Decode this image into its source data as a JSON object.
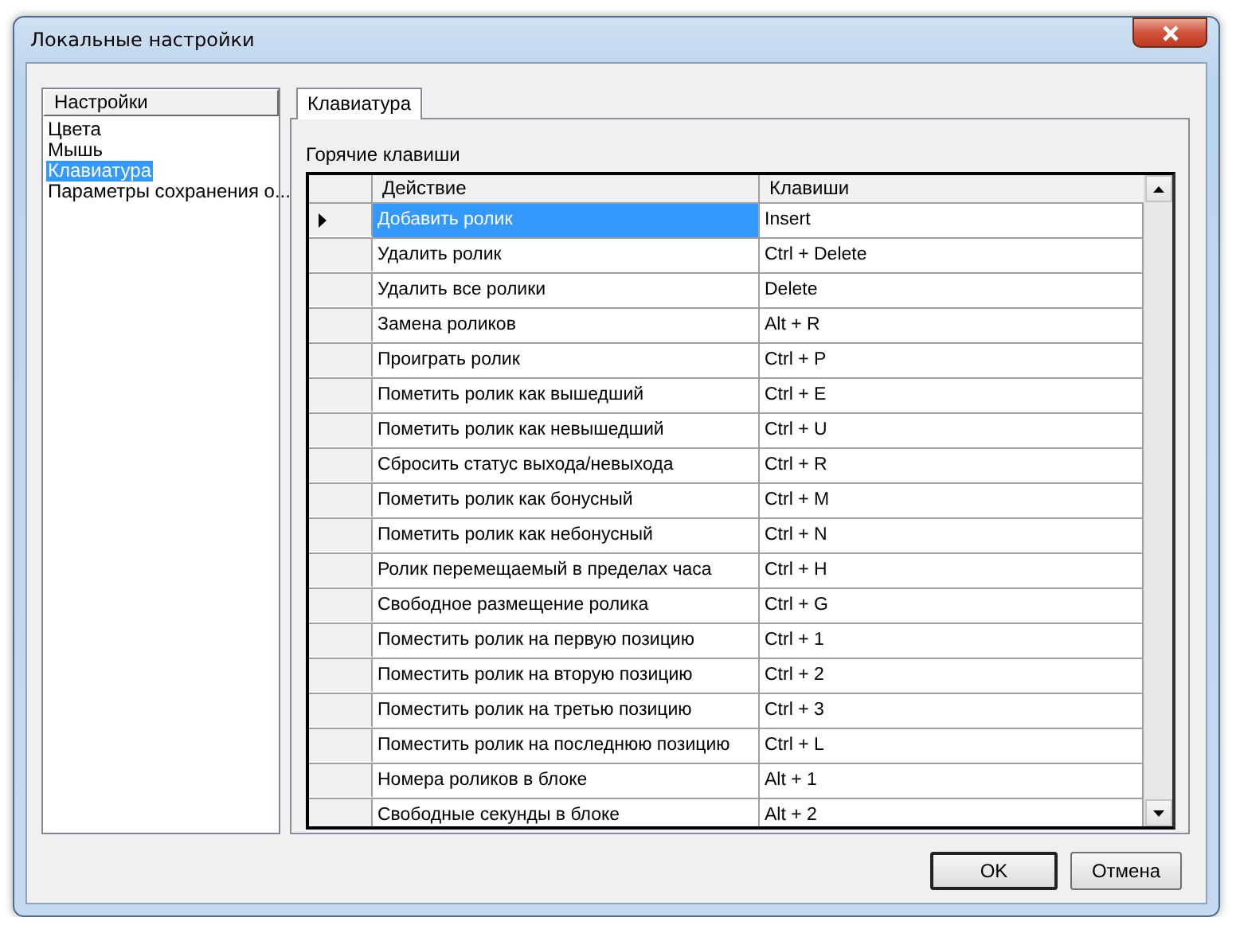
{
  "window": {
    "title": "Локальные настройки"
  },
  "sidebar": {
    "header": "Настройки",
    "items": [
      {
        "label": "Цвета",
        "selected": false
      },
      {
        "label": "Мышь",
        "selected": false
      },
      {
        "label": "Клавиатура",
        "selected": true
      },
      {
        "label": "Параметры сохранения о...",
        "selected": false
      }
    ]
  },
  "tabs": [
    {
      "label": "Клавиатура",
      "selected": true
    }
  ],
  "group_label": "Горячие клавиши",
  "table": {
    "columns": [
      "Действие",
      "Клавиши"
    ],
    "rows": [
      {
        "action": "Добавить ролик",
        "keys": "Insert",
        "selected": true
      },
      {
        "action": "Удалить ролик",
        "keys": "Ctrl + Delete",
        "selected": false
      },
      {
        "action": "Удалить все ролики",
        "keys": "Delete",
        "selected": false
      },
      {
        "action": "Замена роликов",
        "keys": "Alt + R",
        "selected": false
      },
      {
        "action": "Проиграть ролик",
        "keys": "Ctrl + P",
        "selected": false
      },
      {
        "action": "Пометить ролик как вышедший",
        "keys": "Ctrl + E",
        "selected": false
      },
      {
        "action": "Пометить ролик как невышедший",
        "keys": "Ctrl + U",
        "selected": false
      },
      {
        "action": "Сбросить статус выхода/невыхода",
        "keys": "Ctrl + R",
        "selected": false
      },
      {
        "action": "Пометить ролик как бонусный",
        "keys": "Ctrl + M",
        "selected": false
      },
      {
        "action": "Пометить ролик как небонусный",
        "keys": "Ctrl + N",
        "selected": false
      },
      {
        "action": "Ролик перемещаемый в пределах часа",
        "keys": "Ctrl + H",
        "selected": false
      },
      {
        "action": "Свободное размещение ролика",
        "keys": "Ctrl + G",
        "selected": false
      },
      {
        "action": "Поместить ролик на первую позицию",
        "keys": "Ctrl + 1",
        "selected": false
      },
      {
        "action": "Поместить ролик на вторую позицию",
        "keys": "Ctrl + 2",
        "selected": false
      },
      {
        "action": "Поместить ролик на третью позицию",
        "keys": "Ctrl + 3",
        "selected": false
      },
      {
        "action": "Поместить ролик на последнюю позицию",
        "keys": "Ctrl + L",
        "selected": false
      },
      {
        "action": "Номера роликов в блоке",
        "keys": "Alt + 1",
        "selected": false
      },
      {
        "action": "Свободные секунды в блоке",
        "keys": "Alt + 2",
        "selected": false
      }
    ]
  },
  "buttons": [
    {
      "label": "OK",
      "kind": "default"
    },
    {
      "label": "Отмена",
      "kind": "normal"
    }
  ]
}
